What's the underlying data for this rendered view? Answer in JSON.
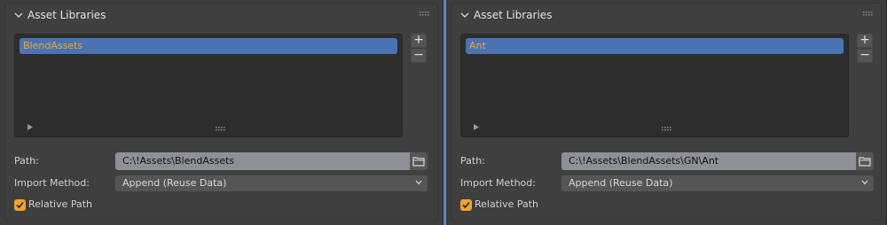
{
  "panels": [
    {
      "header_title": "Asset Libraries",
      "libraries": [
        "BlendAssets"
      ],
      "selected_library": "BlendAssets",
      "path_label": "Path:",
      "path_value": "C:\\!Assets\\BlendAssets",
      "import_method_label": "Import Method:",
      "import_method_value": "Append (Reuse Data)",
      "relative_path_label": "Relative Path",
      "relative_path_checked": true
    },
    {
      "header_title": "Asset Libraries",
      "libraries": [
        "Ant"
      ],
      "selected_library": "Ant",
      "path_label": "Path:",
      "path_value": "C:\\!Assets\\BlendAssets\\GN\\Ant",
      "import_method_label": "Import Method:",
      "import_method_value": "Append (Reuse Data)",
      "relative_path_label": "Relative Path",
      "relative_path_checked": true
    }
  ],
  "buttons": {
    "add": "+",
    "remove": "−"
  },
  "colors": {
    "accent_checkbox": "#f0a232",
    "selection": "#4a73b3",
    "selected_text": "#f4a62a",
    "divider": "#5a88c2"
  },
  "icons": [
    "chevron-down-icon",
    "drag-grip-icon",
    "expand-arrow-icon",
    "resize-grip-icon",
    "folder-icon",
    "checkmark-icon"
  ]
}
